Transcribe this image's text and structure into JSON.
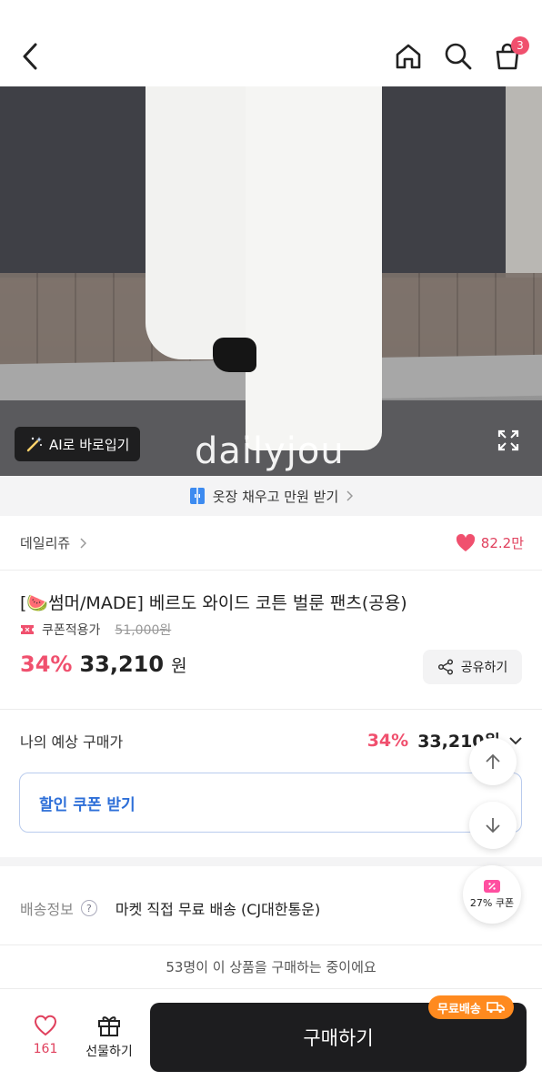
{
  "header": {
    "cart_count": "3"
  },
  "hero": {
    "ai_button_label": "AI로 바로입기",
    "brand_watermark": "dailyjou"
  },
  "promo": {
    "text": "옷장 채우고 만원 받기"
  },
  "brand": {
    "name": "데일리쥬",
    "likes": "82.2만"
  },
  "product": {
    "title": "[🍉썸머/MADE] 베르도 와이드 코튼 벌룬 팬츠(공용)",
    "coupon_label": "쿠폰적용가",
    "original_price": "51,000원",
    "discount": "34%",
    "price": "33,210",
    "currency": "원",
    "share_label": "공유하기"
  },
  "expected": {
    "label": "나의 예상 구매가",
    "discount": "34%",
    "price": "33,210원"
  },
  "coupon": {
    "label": "할인 쿠폰 받기"
  },
  "shipping": {
    "label": "배송정보",
    "value": "마켓 직접 무료 배송 (CJ대한통운)"
  },
  "floating": {
    "coupon_label": "27% 쿠폰"
  },
  "notice": {
    "text": "53명이 이 상품을 구매하는 중이에요"
  },
  "bottom": {
    "wish_count": "161",
    "gift_label": "선물하기",
    "buy_label": "구매하기",
    "free_ship_label": "무료배송"
  },
  "colors": {
    "accent": "#f0506e",
    "link": "#2e6fd8",
    "free_ship": "#ff8a1f",
    "buy_button": "#1d1d1f"
  }
}
